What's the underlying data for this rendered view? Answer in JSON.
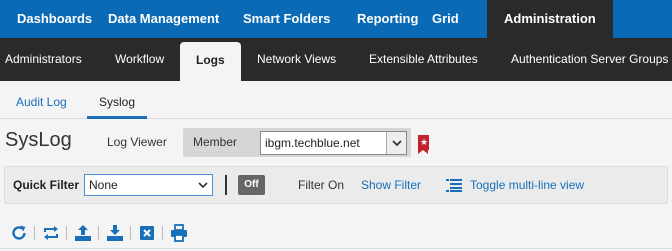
{
  "top_nav": {
    "items": [
      {
        "label": "Dashboards"
      },
      {
        "label": "Data Management"
      },
      {
        "label": "Smart Folders"
      },
      {
        "label": "Reporting"
      },
      {
        "label": "Grid"
      },
      {
        "label": "Administration",
        "active": true
      }
    ]
  },
  "sub_nav": {
    "items": [
      {
        "label": "Administrators"
      },
      {
        "label": "Workflow"
      },
      {
        "label": "Logs",
        "active": true
      },
      {
        "label": "Network Views"
      },
      {
        "label": "Extensible Attributes"
      },
      {
        "label": "Authentication Server Groups"
      }
    ]
  },
  "tabs": [
    {
      "label": "Audit Log"
    },
    {
      "label": "Syslog",
      "active": true
    }
  ],
  "page": {
    "title": "SysLog",
    "log_viewer_label": "Log Viewer",
    "member_label": "Member",
    "member_value": "ibgm.techblue.net"
  },
  "filter_bar": {
    "quick_filter_label": "Quick Filter",
    "quick_filter_value": "None",
    "toggle_state": "Off",
    "filter_on_label": "Filter On",
    "show_filter_label": "Show Filter",
    "toggle_multiline_label": "Toggle multi-line view"
  },
  "toolbar": {
    "icons": [
      "refresh-icon",
      "follow-icon",
      "export-icon",
      "download-icon",
      "clear-icon",
      "print-icon"
    ]
  },
  "colors": {
    "nav_blue": "#0a6ab5",
    "dark_bar": "#2a2a2a",
    "link_blue": "#1a6fba",
    "bookmark_red": "#c2232f"
  }
}
